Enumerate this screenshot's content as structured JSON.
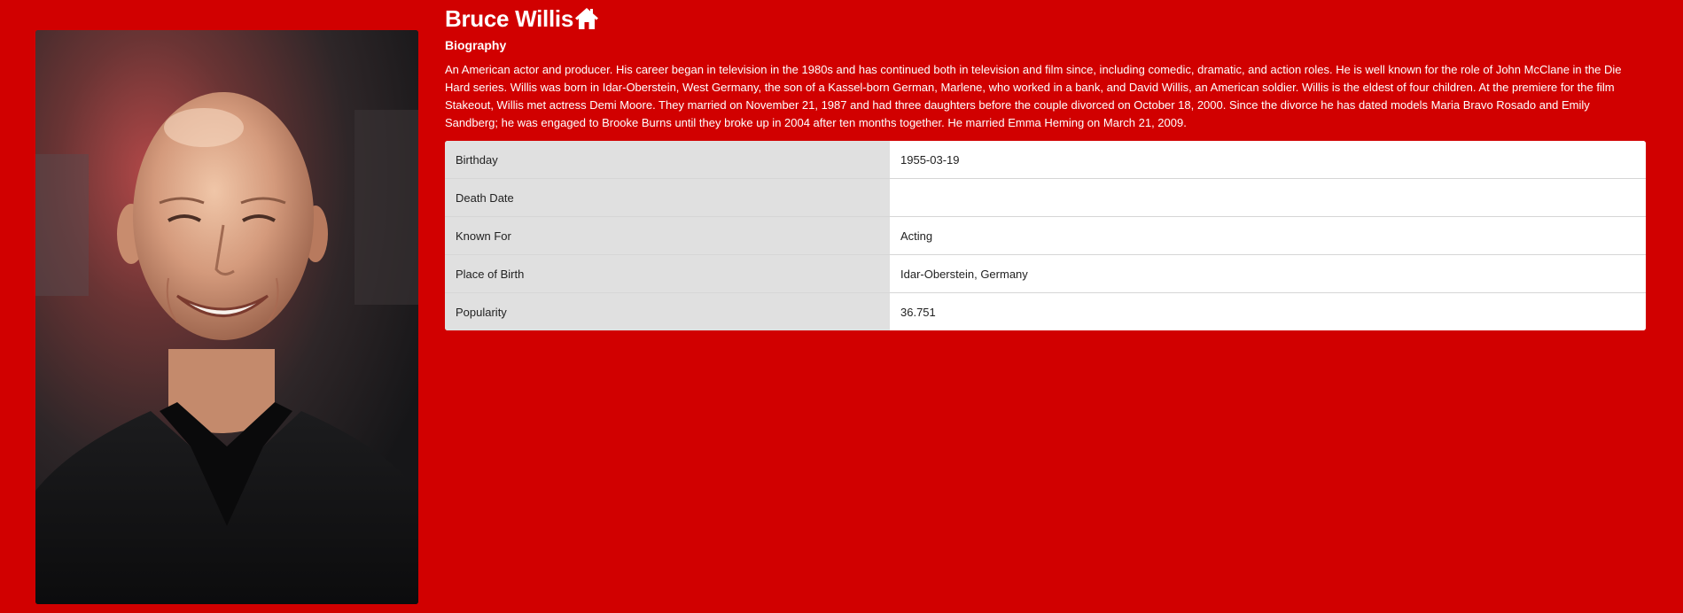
{
  "person": {
    "name": "Bruce Willis",
    "section_heading": "Biography",
    "biography": "An American actor and producer. His career began in television in the 1980s and has continued both in television and film since, including comedic, dramatic, and action roles. He is well known for the role of John McClane in the Die Hard series. Willis was born in Idar-Oberstein, West Germany, the son of a Kassel-born German, Marlene, who worked in a bank, and David Willis, an American soldier. Willis is the eldest of four children. At the premiere for the film Stakeout, Willis met actress Demi Moore. They married on November 21, 1987 and had three daughters before the couple divorced on October 18, 2000. Since the divorce he has dated models Maria Bravo Rosado and Emily Sandberg; he was engaged to Brooke Burns until they broke up in 2004 after ten months together. He married Emma Heming on March 21, 2009.",
    "photo_alt": "Bruce Willis"
  },
  "details": [
    {
      "label": "Birthday",
      "value": "1955-03-19"
    },
    {
      "label": "Death Date",
      "value": ""
    },
    {
      "label": "Known For",
      "value": "Acting"
    },
    {
      "label": "Place of Birth",
      "value": "Idar-Oberstein, Germany"
    },
    {
      "label": "Popularity",
      "value": "36.751"
    }
  ],
  "icons": {
    "home": "home-icon"
  },
  "colors": {
    "background": "#d10000",
    "text_on_background": "#ffffff",
    "label_cell": "#e0e0e0",
    "value_cell": "#ffffff"
  }
}
